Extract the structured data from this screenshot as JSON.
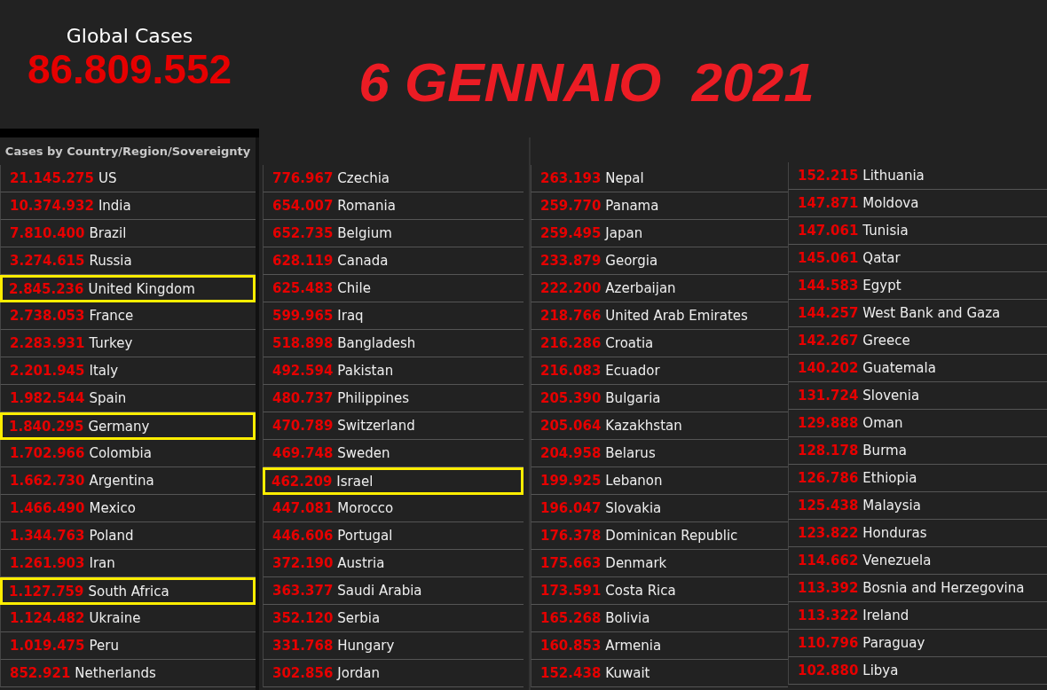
{
  "global_cases": {
    "label": "Global Cases",
    "value": "86.809.552"
  },
  "date_title": "6 GENNAIO  2021",
  "list_title": "Cases by Country/Region/Sovereignty",
  "columns": [
    [
      {
        "cases": "21.145.275",
        "country": "US",
        "highlighted": false
      },
      {
        "cases": "10.374.932",
        "country": "India",
        "highlighted": false
      },
      {
        "cases": "7.810.400",
        "country": "Brazil",
        "highlighted": false
      },
      {
        "cases": "3.274.615",
        "country": "Russia",
        "highlighted": false
      },
      {
        "cases": "2.845.236",
        "country": "United Kingdom",
        "highlighted": true
      },
      {
        "cases": "2.738.053",
        "country": "France",
        "highlighted": false
      },
      {
        "cases": "2.283.931",
        "country": "Turkey",
        "highlighted": false
      },
      {
        "cases": "2.201.945",
        "country": "Italy",
        "highlighted": false
      },
      {
        "cases": "1.982.544",
        "country": "Spain",
        "highlighted": false
      },
      {
        "cases": "1.840.295",
        "country": "Germany",
        "highlighted": true
      },
      {
        "cases": "1.702.966",
        "country": "Colombia",
        "highlighted": false
      },
      {
        "cases": "1.662.730",
        "country": "Argentina",
        "highlighted": false
      },
      {
        "cases": "1.466.490",
        "country": "Mexico",
        "highlighted": false
      },
      {
        "cases": "1.344.763",
        "country": "Poland",
        "highlighted": false
      },
      {
        "cases": "1.261.903",
        "country": "Iran",
        "highlighted": false
      },
      {
        "cases": "1.127.759",
        "country": "South Africa",
        "highlighted": true
      },
      {
        "cases": "1.124.482",
        "country": "Ukraine",
        "highlighted": false
      },
      {
        "cases": "1.019.475",
        "country": "Peru",
        "highlighted": false
      },
      {
        "cases": "852.921",
        "country": "Netherlands",
        "highlighted": false
      }
    ],
    [
      {
        "cases": "776.967",
        "country": "Czechia",
        "highlighted": false
      },
      {
        "cases": "654.007",
        "country": "Romania",
        "highlighted": false
      },
      {
        "cases": "652.735",
        "country": "Belgium",
        "highlighted": false
      },
      {
        "cases": "628.119",
        "country": "Canada",
        "highlighted": false
      },
      {
        "cases": "625.483",
        "country": "Chile",
        "highlighted": false
      },
      {
        "cases": "599.965",
        "country": "Iraq",
        "highlighted": false
      },
      {
        "cases": "518.898",
        "country": "Bangladesh",
        "highlighted": false
      },
      {
        "cases": "492.594",
        "country": "Pakistan",
        "highlighted": false
      },
      {
        "cases": "480.737",
        "country": "Philippines",
        "highlighted": false
      },
      {
        "cases": "470.789",
        "country": "Switzerland",
        "highlighted": false
      },
      {
        "cases": "469.748",
        "country": "Sweden",
        "highlighted": false
      },
      {
        "cases": "462.209",
        "country": "Israel",
        "highlighted": true
      },
      {
        "cases": "447.081",
        "country": "Morocco",
        "highlighted": false
      },
      {
        "cases": "446.606",
        "country": "Portugal",
        "highlighted": false
      },
      {
        "cases": "372.190",
        "country": "Austria",
        "highlighted": false
      },
      {
        "cases": "363.377",
        "country": "Saudi Arabia",
        "highlighted": false
      },
      {
        "cases": "352.120",
        "country": "Serbia",
        "highlighted": false
      },
      {
        "cases": "331.768",
        "country": "Hungary",
        "highlighted": false
      },
      {
        "cases": "302.856",
        "country": "Jordan",
        "highlighted": false
      }
    ],
    [
      {
        "cases": "263.193",
        "country": "Nepal",
        "highlighted": false
      },
      {
        "cases": "259.770",
        "country": "Panama",
        "highlighted": false
      },
      {
        "cases": "259.495",
        "country": "Japan",
        "highlighted": false
      },
      {
        "cases": "233.879",
        "country": "Georgia",
        "highlighted": false
      },
      {
        "cases": "222.200",
        "country": "Azerbaijan",
        "highlighted": false
      },
      {
        "cases": "218.766",
        "country": "United Arab Emirates",
        "highlighted": false
      },
      {
        "cases": "216.286",
        "country": "Croatia",
        "highlighted": false
      },
      {
        "cases": "216.083",
        "country": "Ecuador",
        "highlighted": false
      },
      {
        "cases": "205.390",
        "country": "Bulgaria",
        "highlighted": false
      },
      {
        "cases": "205.064",
        "country": "Kazakhstan",
        "highlighted": false
      },
      {
        "cases": "204.958",
        "country": "Belarus",
        "highlighted": false
      },
      {
        "cases": "199.925",
        "country": "Lebanon",
        "highlighted": false
      },
      {
        "cases": "196.047",
        "country": "Slovakia",
        "highlighted": false
      },
      {
        "cases": "176.378",
        "country": "Dominican Republic",
        "highlighted": false
      },
      {
        "cases": "175.663",
        "country": "Denmark",
        "highlighted": false
      },
      {
        "cases": "173.591",
        "country": "Costa Rica",
        "highlighted": false
      },
      {
        "cases": "165.268",
        "country": "Bolivia",
        "highlighted": false
      },
      {
        "cases": "160.853",
        "country": "Armenia",
        "highlighted": false
      },
      {
        "cases": "152.438",
        "country": "Kuwait",
        "highlighted": false
      }
    ],
    [
      {
        "cases": "152.215",
        "country": "Lithuania",
        "highlighted": false
      },
      {
        "cases": "147.871",
        "country": "Moldova",
        "highlighted": false
      },
      {
        "cases": "147.061",
        "country": "Tunisia",
        "highlighted": false
      },
      {
        "cases": "145.061",
        "country": "Qatar",
        "highlighted": false
      },
      {
        "cases": "144.583",
        "country": "Egypt",
        "highlighted": false
      },
      {
        "cases": "144.257",
        "country": "West Bank and Gaza",
        "highlighted": false
      },
      {
        "cases": "142.267",
        "country": "Greece",
        "highlighted": false
      },
      {
        "cases": "140.202",
        "country": "Guatemala",
        "highlighted": false
      },
      {
        "cases": "131.724",
        "country": "Slovenia",
        "highlighted": false
      },
      {
        "cases": "129.888",
        "country": "Oman",
        "highlighted": false
      },
      {
        "cases": "128.178",
        "country": "Burma",
        "highlighted": false
      },
      {
        "cases": "126.786",
        "country": "Ethiopia",
        "highlighted": false
      },
      {
        "cases": "125.438",
        "country": "Malaysia",
        "highlighted": false
      },
      {
        "cases": "123.822",
        "country": "Honduras",
        "highlighted": false
      },
      {
        "cases": "114.662",
        "country": "Venezuela",
        "highlighted": false
      },
      {
        "cases": "113.392",
        "country": "Bosnia and Herzegovina",
        "highlighted": false
      },
      {
        "cases": "113.322",
        "country": "Ireland",
        "highlighted": false
      },
      {
        "cases": "110.796",
        "country": "Paraguay",
        "highlighted": false
      },
      {
        "cases": "102.880",
        "country": "Libya",
        "highlighted": false
      }
    ]
  ]
}
